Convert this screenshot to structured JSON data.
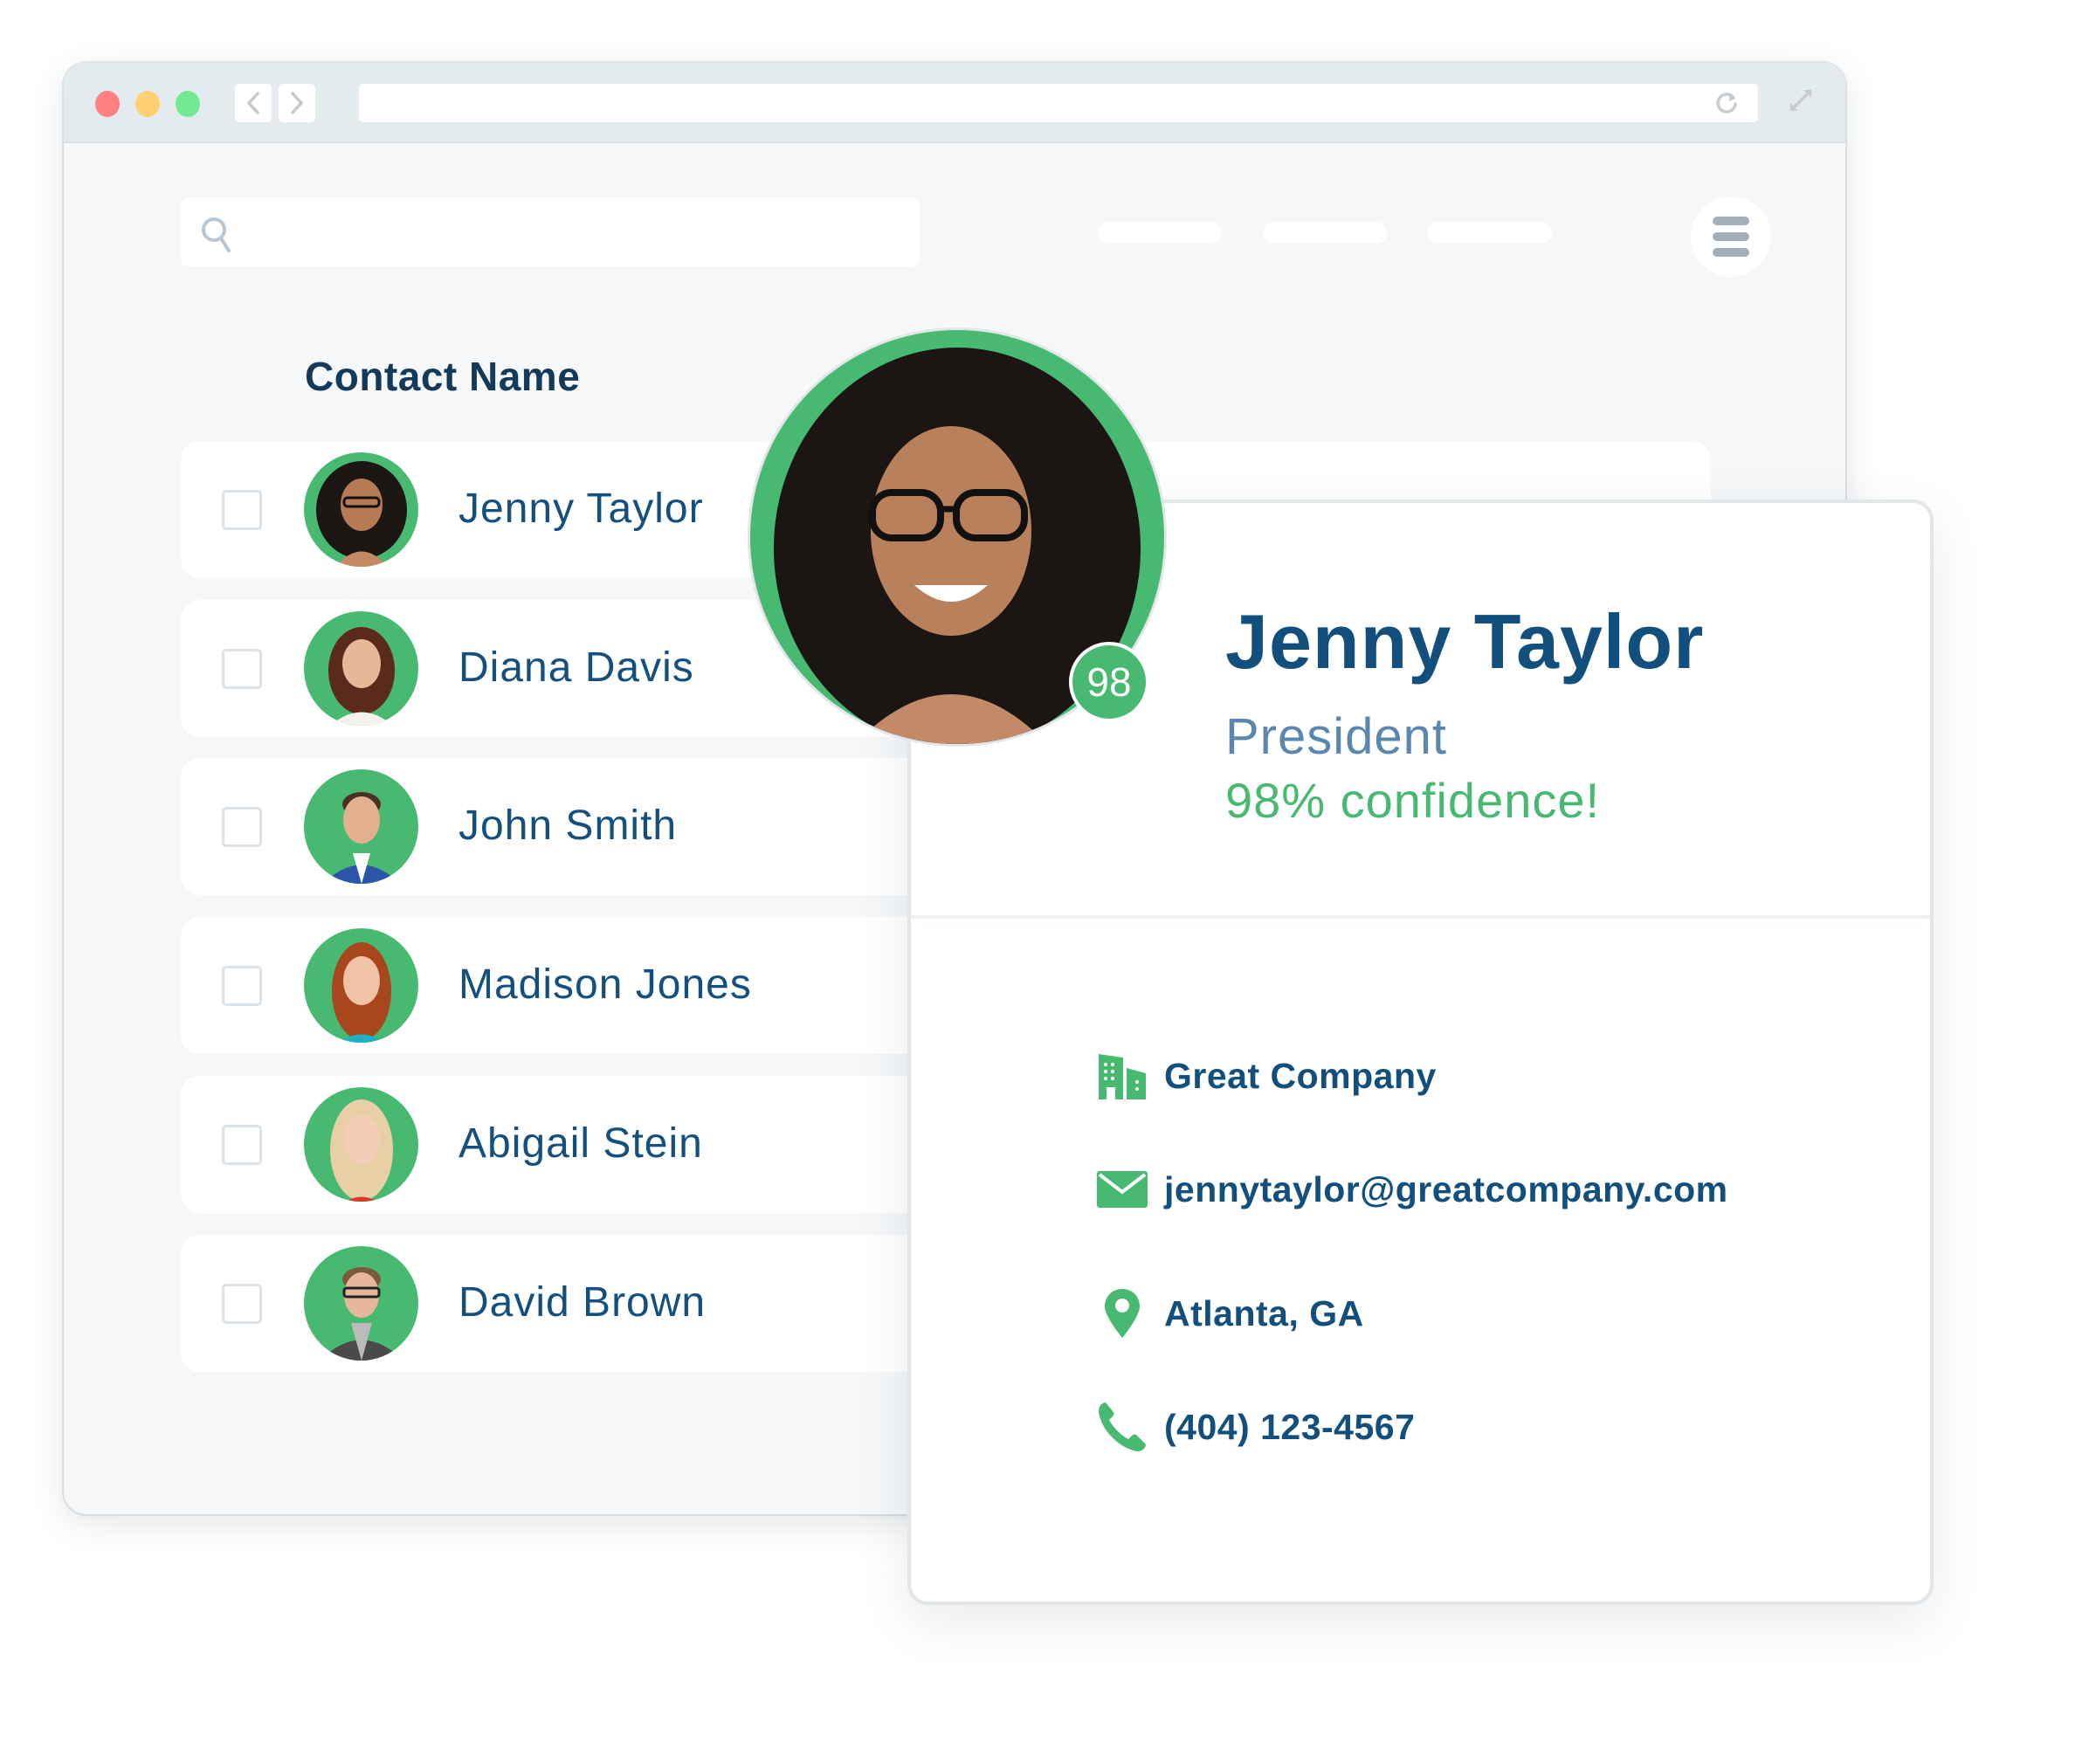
{
  "browser": {
    "controls": [
      "close",
      "minimize",
      "maximize"
    ],
    "nav": {
      "back_icon": "chevron-left-icon",
      "forward_icon": "chevron-right-icon"
    },
    "address": {
      "value": "",
      "reload_icon": "reload-icon"
    },
    "expand_icon": "expand-icon"
  },
  "toolbar": {
    "search": {
      "placeholder": "",
      "value": "",
      "icon": "search-icon"
    },
    "nav_pills": [
      "",
      "",
      ""
    ],
    "menu_icon": "hamburger-menu-icon"
  },
  "contacts": {
    "column_header": "Contact Name",
    "rows": [
      {
        "name": "Jenny Taylor",
        "checked": false
      },
      {
        "name": "Diana Davis",
        "checked": false
      },
      {
        "name": "John Smith",
        "checked": false
      },
      {
        "name": "Madison Jones",
        "checked": false
      },
      {
        "name": "Abigail Stein",
        "checked": false
      },
      {
        "name": "David Brown",
        "checked": false
      }
    ]
  },
  "profile_card": {
    "name": "Jenny Taylor",
    "title": "President",
    "confidence_text": "98% confidence!",
    "score_badge": "98",
    "confidence_percent": 98,
    "company": "Great Company",
    "email": "jennytaylor@greatcompany.com",
    "location": "Atlanta, GA",
    "phone": "(404) 123-4567"
  },
  "colors": {
    "accent_green": "#48b971",
    "name_blue": "#134f7d",
    "title_blue": "#5a87ad",
    "header_navy": "#143a5a",
    "window_bg": "#f5f7f9",
    "titlebar_bg": "#e4ebef",
    "dot_red": "#ff8080",
    "dot_yellow": "#ffd072",
    "dot_green": "#71ea93"
  }
}
